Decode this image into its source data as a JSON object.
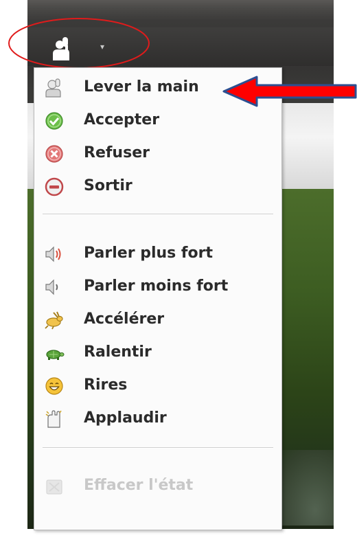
{
  "toolbar": {
    "hand_button": "raise-hand-status",
    "dropdown_glyph": "▾"
  },
  "menu": {
    "group_status": [
      {
        "label": "Lever la main",
        "icon": "raise-hand-icon"
      },
      {
        "label": "Accepter",
        "icon": "check-circle-icon"
      },
      {
        "label": "Refuser",
        "icon": "x-circle-icon"
      },
      {
        "label": "Sortir",
        "icon": "minus-circle-icon"
      }
    ],
    "group_feedback": [
      {
        "label": "Parler plus fort",
        "icon": "speaker-loud-icon"
      },
      {
        "label": "Parler moins fort",
        "icon": "speaker-quiet-icon"
      },
      {
        "label": "Accélérer",
        "icon": "rabbit-icon"
      },
      {
        "label": "Ralentir",
        "icon": "turtle-icon"
      },
      {
        "label": "Rires",
        "icon": "laugh-icon"
      },
      {
        "label": "Applaudir",
        "icon": "applause-icon"
      }
    ],
    "clear": {
      "label": "Effacer l'état",
      "icon": "clear-status-icon",
      "enabled": false
    }
  },
  "annotations": {
    "arrow_color": "#ff0000",
    "arrow_outline": "#2c4f91",
    "ellipse_color": "#e01b1b"
  }
}
